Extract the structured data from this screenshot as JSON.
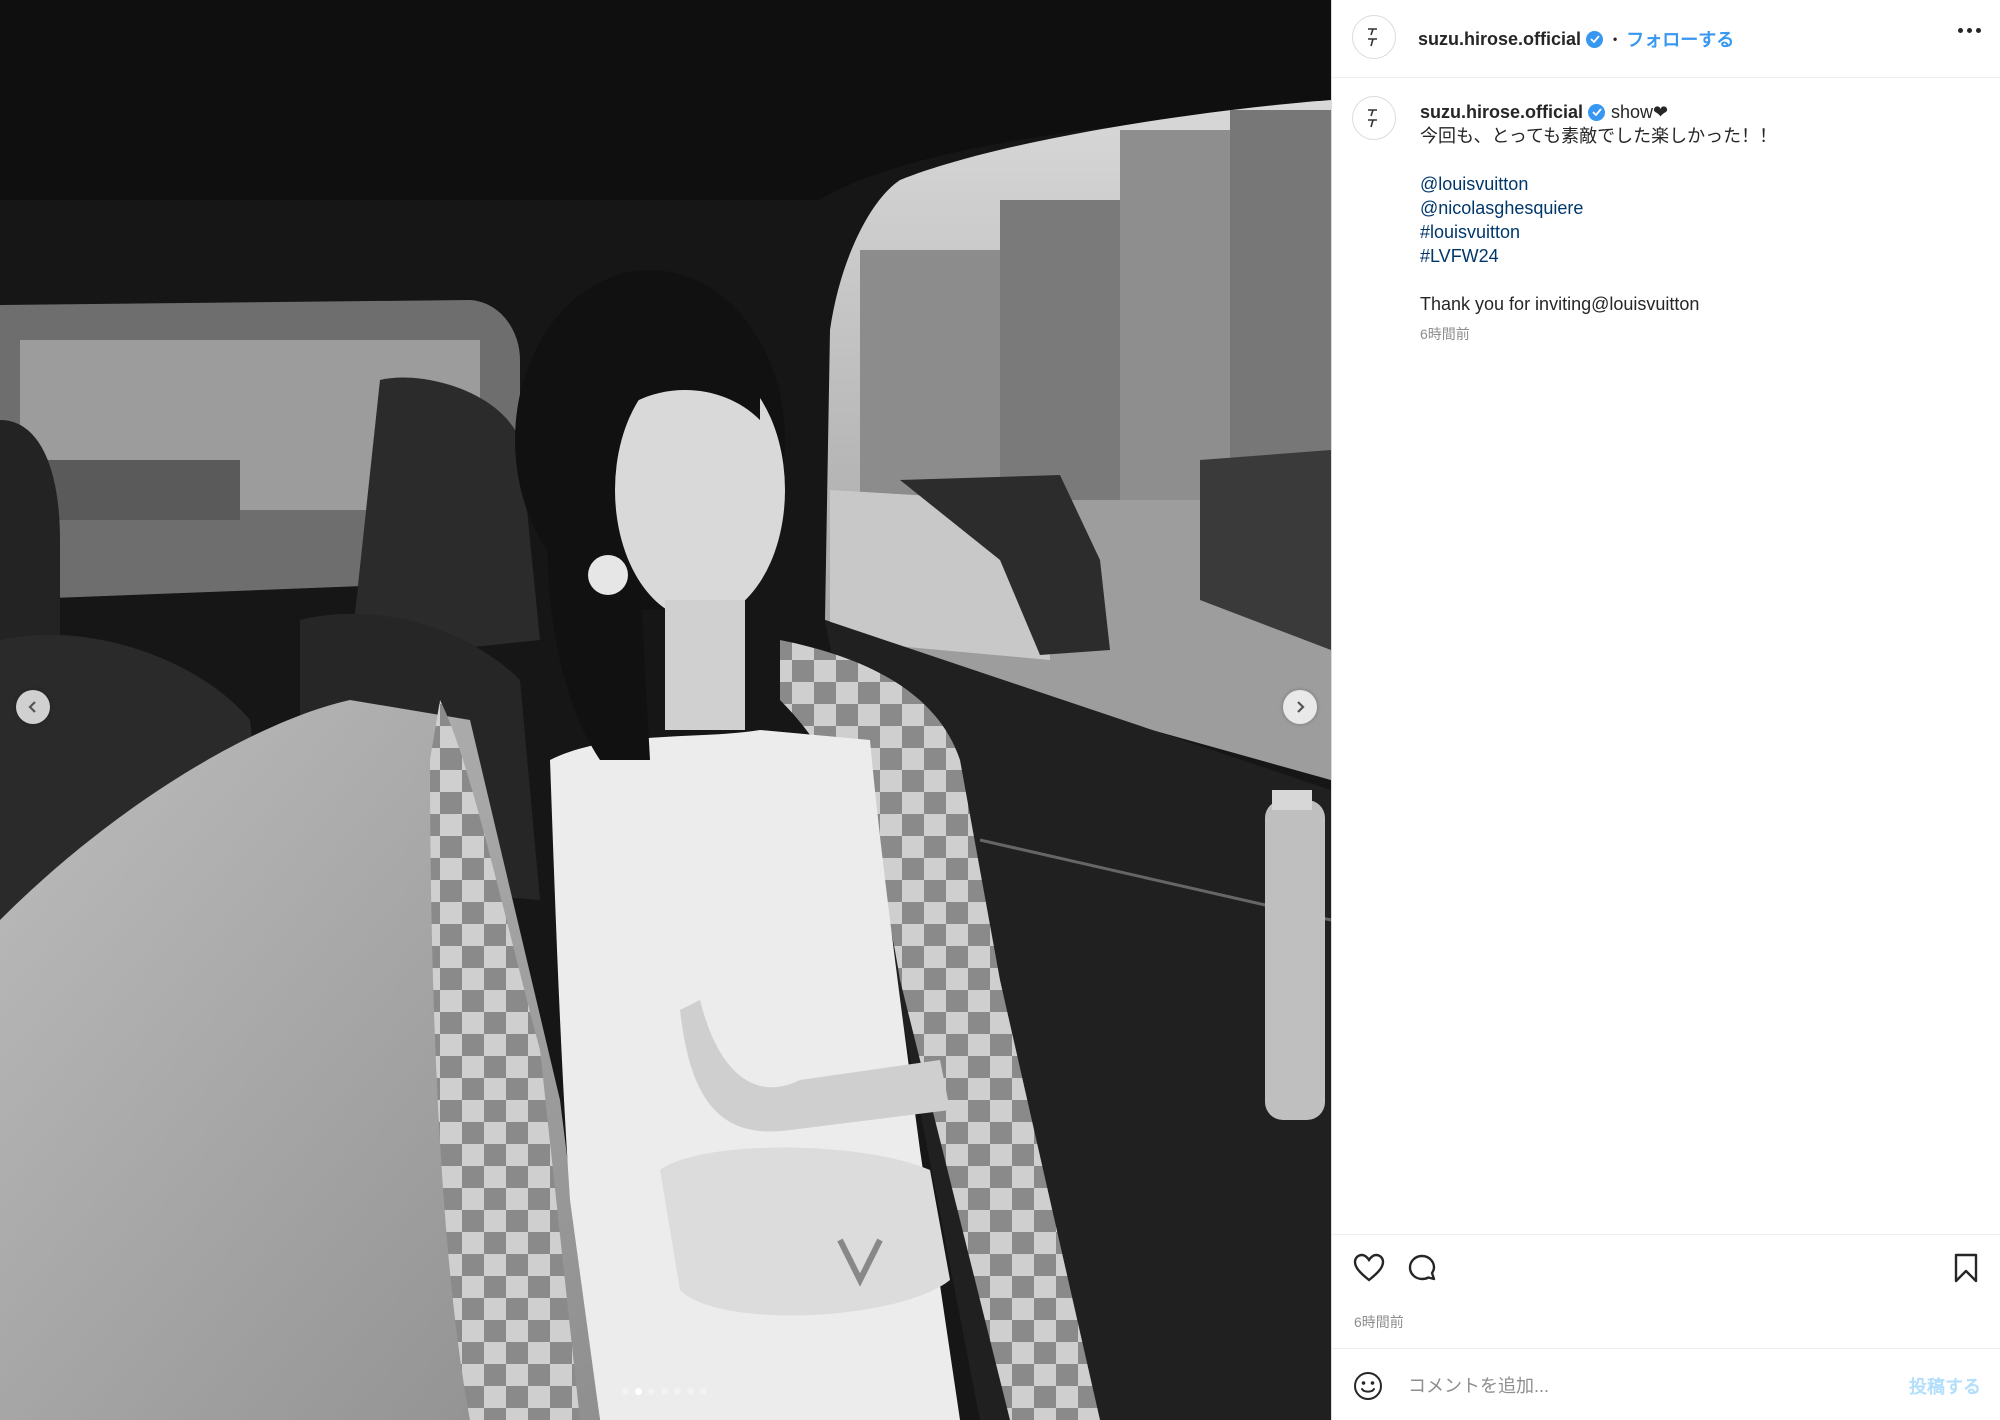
{
  "post": {
    "username": "suzu.hirose.official",
    "verified": true,
    "follow_label": "フォローする",
    "separator": "•",
    "avatar_mark": "ｲ\nｲ"
  },
  "caption": {
    "username": "suzu.hirose.official",
    "first_line": "show❤",
    "second_line": "今回も、とっても素敵でした楽しかった！！",
    "links": [
      "@louisvuitton",
      "@nicolasghesquiere",
      "#louisvuitton",
      "#LVFW24"
    ],
    "closing": "Thank you for inviting@louisvuitton",
    "time": "6時間前"
  },
  "footer": {
    "time": "6時間前",
    "comment_placeholder": "コメントを追加...",
    "post_label": "投稿する"
  },
  "carousel": {
    "total_slides": 7,
    "active_slide": 1
  },
  "colors": {
    "accent": "#3897f0",
    "link": "#00376b",
    "muted": "#8e8e8e",
    "post_disabled": "#b2dffc"
  }
}
